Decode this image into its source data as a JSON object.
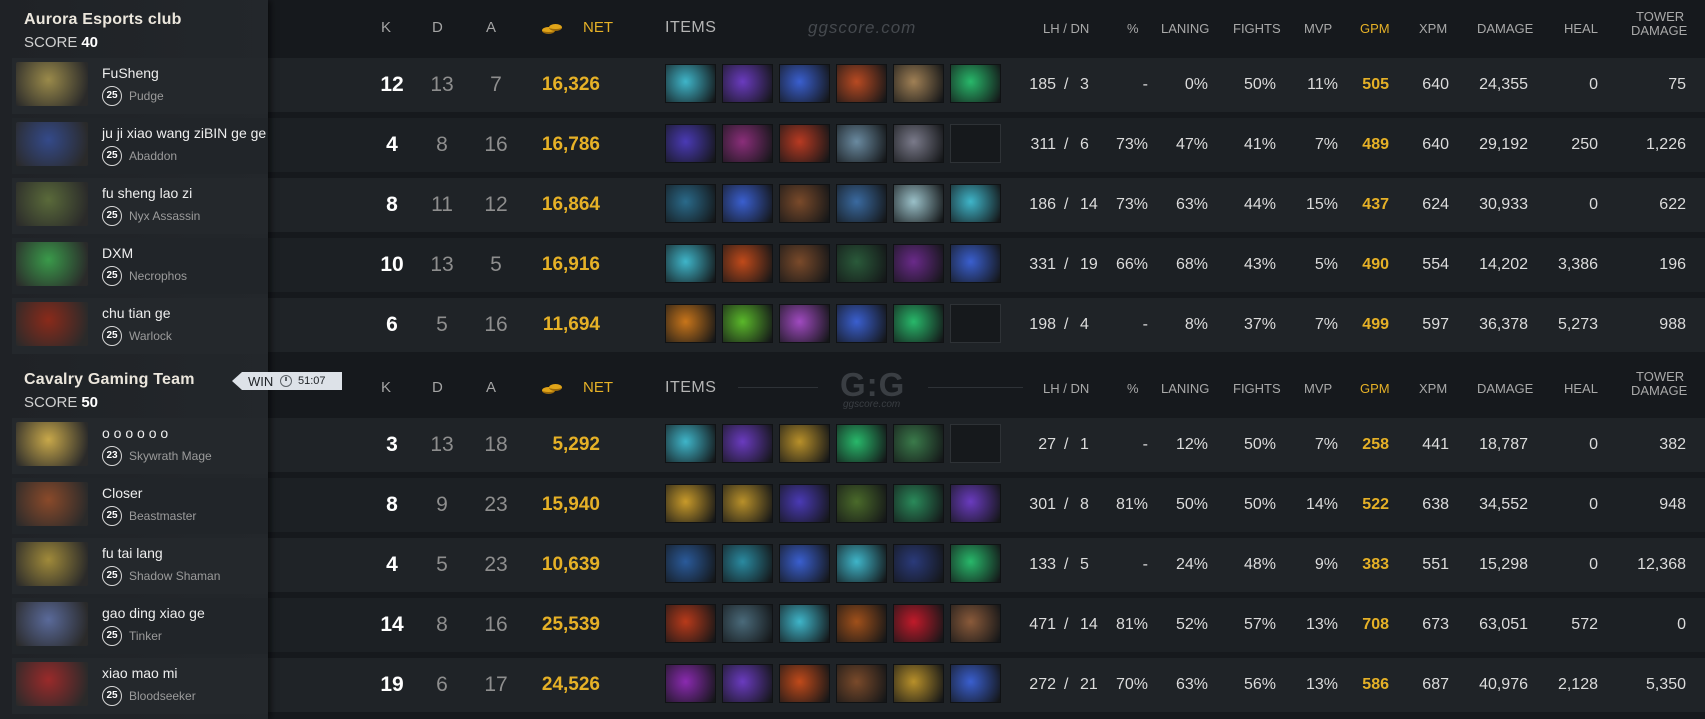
{
  "teams": [
    {
      "name": "Aurora Esports club",
      "score_label": "SCORE",
      "score": "40",
      "players": [
        {
          "name": "FuSheng",
          "level": "25",
          "hero": "Pudge",
          "avatar_color": "#9a8a4a",
          "k": "12",
          "d": "13",
          "a": "7",
          "net": "16,326",
          "items": [
            "#3fb5c9",
            "#6a3bbf",
            "#3a5fcf",
            "#b84a22",
            "#a08055",
            "#28b86a"
          ],
          "lh": "185",
          "dn": "3",
          "pct": "-",
          "laning": "0%",
          "fights": "50%",
          "mvp": "11%",
          "gpm": "505",
          "xpm": "640",
          "damage": "24,355",
          "heal": "0",
          "tower": "75"
        },
        {
          "name": "ju ji xiao wang ziBIN ge ge",
          "level": "25",
          "hero": "Abaddon",
          "avatar_color": "#344a8a",
          "k": "4",
          "d": "8",
          "a": "16",
          "net": "16,786",
          "items": [
            "#4a3ab5",
            "#8a2e7a",
            "#b83a22",
            "#6a8aa0",
            "#7a7a8a",
            ""
          ],
          "lh": "311",
          "dn": "6",
          "pct": "73%",
          "laning": "47%",
          "fights": "41%",
          "mvp": "7%",
          "gpm": "489",
          "xpm": "640",
          "damage": "29,192",
          "heal": "250",
          "tower": "1,226"
        },
        {
          "name": "fu sheng lao zi",
          "level": "25",
          "hero": "Nyx Assassin",
          "avatar_color": "#5a6a3a",
          "k": "8",
          "d": "11",
          "a": "12",
          "net": "16,864",
          "items": [
            "#2a6a8a",
            "#3a5fcf",
            "#7a4a2a",
            "#3a6aa0",
            "#9ac0c8",
            "#3fb5c9"
          ],
          "lh": "186",
          "dn": "14",
          "pct": "73%",
          "laning": "63%",
          "fights": "44%",
          "mvp": "15%",
          "gpm": "437",
          "xpm": "624",
          "damage": "30,933",
          "heal": "0",
          "tower": "622"
        },
        {
          "name": "DXM",
          "level": "25",
          "hero": "Necrophos",
          "avatar_color": "#3a9a4a",
          "k": "10",
          "d": "13",
          "a": "5",
          "net": "16,916",
          "items": [
            "#3fb5c9",
            "#c04a1a",
            "#7a4a2a",
            "#2a5a3a",
            "#6a2a8a",
            "#3a5fcf"
          ],
          "lh": "331",
          "dn": "19",
          "pct": "66%",
          "laning": "68%",
          "fights": "43%",
          "mvp": "5%",
          "gpm": "490",
          "xpm": "554",
          "damage": "14,202",
          "heal": "3,386",
          "tower": "196"
        },
        {
          "name": "chu tian ge",
          "level": "25",
          "hero": "Warlock",
          "avatar_color": "#8a2a1a",
          "k": "6",
          "d": "5",
          "a": "16",
          "net": "11,694",
          "items": [
            "#c8751a",
            "#5ab82a",
            "#a04ac0",
            "#3a5fcf",
            "#28b86a",
            ""
          ],
          "lh": "198",
          "dn": "4",
          "pct": "-",
          "laning": "8%",
          "fights": "37%",
          "mvp": "7%",
          "gpm": "499",
          "xpm": "597",
          "damage": "36,378",
          "heal": "5,273",
          "tower": "988"
        }
      ]
    },
    {
      "name": "Cavalry Gaming Team",
      "score_label": "SCORE",
      "score": "50",
      "result": "WIN",
      "duration": "51:07",
      "players": [
        {
          "name": "o o o o o o",
          "level": "23",
          "hero": "Skywrath Mage",
          "avatar_color": "#c8a84a",
          "k": "3",
          "d": "13",
          "a": "18",
          "net": "5,292",
          "items": [
            "#3fb5c9",
            "#6a3bbf",
            "#b8902a",
            "#28b86a",
            "#3a7a4a",
            ""
          ],
          "lh": "27",
          "dn": "1",
          "pct": "-",
          "laning": "12%",
          "fights": "50%",
          "mvp": "7%",
          "gpm": "258",
          "xpm": "441",
          "damage": "18,787",
          "heal": "0",
          "tower": "382"
        },
        {
          "name": "Closer",
          "level": "25",
          "hero": "Beastmaster",
          "avatar_color": "#8a4a2a",
          "k": "8",
          "d": "9",
          "a": "23",
          "net": "15,940",
          "items": [
            "#c89a2a",
            "#b8902a",
            "#4a3ab5",
            "#4a6a2a",
            "#2a8a5a",
            "#6a3bbf"
          ],
          "lh": "301",
          "dn": "8",
          "pct": "81%",
          "laning": "50%",
          "fights": "50%",
          "mvp": "14%",
          "gpm": "522",
          "xpm": "638",
          "damage": "34,552",
          "heal": "0",
          "tower": "948"
        },
        {
          "name": "fu tai lang",
          "level": "25",
          "hero": "Shadow Shaman",
          "avatar_color": "#a08a3a",
          "k": "4",
          "d": "5",
          "a": "23",
          "net": "10,639",
          "items": [
            "#2a5a9a",
            "#2a8aa0",
            "#3a5fcf",
            "#3fb5c9",
            "#2a3a7a",
            "#28b86a"
          ],
          "lh": "133",
          "dn": "5",
          "pct": "-",
          "laning": "24%",
          "fights": "48%",
          "mvp": "9%",
          "gpm": "383",
          "xpm": "551",
          "damage": "15,298",
          "heal": "0",
          "tower": "12,368"
        },
        {
          "name": "gao ding xiao ge",
          "level": "25",
          "hero": "Tinker",
          "avatar_color": "#5a6a9a",
          "k": "14",
          "d": "8",
          "a": "16",
          "net": "25,539",
          "items": [
            "#b83a1a",
            "#4a6a7a",
            "#3fb5c9",
            "#a0501a",
            "#c01a2a",
            "#8a5a3a"
          ],
          "lh": "471",
          "dn": "14",
          "pct": "81%",
          "laning": "52%",
          "fights": "57%",
          "mvp": "13%",
          "gpm": "708",
          "xpm": "673",
          "damage": "63,051",
          "heal": "572",
          "tower": "0"
        },
        {
          "name": "xiao mao mi",
          "level": "25",
          "hero": "Bloodseeker",
          "avatar_color": "#9a2a2a",
          "k": "19",
          "d": "6",
          "a": "17",
          "net": "24,526",
          "items": [
            "#8a2ab0",
            "#6a3bbf",
            "#c04a1a",
            "#7a4a2a",
            "#b8902a",
            "#3a5fcf"
          ],
          "lh": "272",
          "dn": "21",
          "pct": "70%",
          "laning": "63%",
          "fights": "56%",
          "mvp": "13%",
          "gpm": "586",
          "xpm": "687",
          "damage": "40,976",
          "heal": "2,128",
          "tower": "5,350"
        }
      ]
    }
  ],
  "columns": {
    "k": "K",
    "d": "D",
    "a": "A",
    "net": "NET",
    "items": "ITEMS",
    "lhdn": "LH  /  DN",
    "pct": "%",
    "laning": "LANING",
    "fights": "FIGHTS",
    "mvp": "MVP",
    "gpm": "GPM",
    "xpm": "XPM",
    "damage": "DAMAGE",
    "heal": "HEAL",
    "tower1": "TOWER",
    "tower2": "DAMAGE"
  },
  "watermark": {
    "site": "ggscore.com",
    "logo": "G:G",
    "sub": "ggscore.com"
  },
  "colors": {
    "gold": "#e6b127",
    "background": "#16191d",
    "sidebar": "#23272b"
  }
}
